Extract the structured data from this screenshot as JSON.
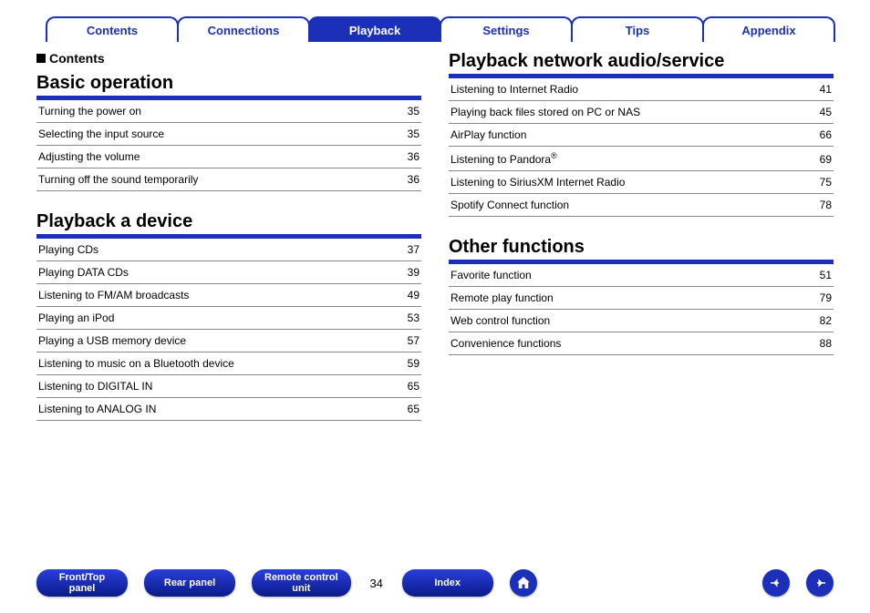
{
  "tabs": [
    {
      "label": "Contents",
      "active": false
    },
    {
      "label": "Connections",
      "active": false
    },
    {
      "label": "Playback",
      "active": true
    },
    {
      "label": "Settings",
      "active": false
    },
    {
      "label": "Tips",
      "active": false
    },
    {
      "label": "Appendix",
      "active": false
    }
  ],
  "contents_header": "Contents",
  "sections": {
    "basic_operation": {
      "title": "Basic operation",
      "rows": [
        {
          "label": "Turning the power on",
          "page": "35"
        },
        {
          "label": "Selecting the input source",
          "page": "35"
        },
        {
          "label": "Adjusting the volume",
          "page": "36"
        },
        {
          "label": "Turning off the sound temporarily",
          "page": "36"
        }
      ]
    },
    "playback_device": {
      "title": "Playback a device",
      "rows": [
        {
          "label": "Playing CDs",
          "page": "37"
        },
        {
          "label": "Playing DATA CDs",
          "page": "39"
        },
        {
          "label": "Listening to FM/AM broadcasts",
          "page": "49"
        },
        {
          "label": "Playing an iPod",
          "page": "53"
        },
        {
          "label": "Playing a USB memory device",
          "page": "57"
        },
        {
          "label": "Listening to music on a Bluetooth device",
          "page": "59"
        },
        {
          "label": "Listening to DIGITAL IN",
          "page": "65"
        },
        {
          "label": "Listening to ANALOG IN",
          "page": "65"
        }
      ]
    },
    "network_audio": {
      "title": "Playback network audio/service",
      "rows": [
        {
          "label": "Listening to Internet Radio",
          "page": "41"
        },
        {
          "label": "Playing back files stored on PC or NAS",
          "page": "45"
        },
        {
          "label": "AirPlay function",
          "page": "66"
        },
        {
          "label": "Listening to Pandora",
          "sup": "®",
          "page": "69"
        },
        {
          "label": "Listening to SiriusXM Internet Radio",
          "page": "75"
        },
        {
          "label": "Spotify Connect function",
          "page": "78"
        }
      ]
    },
    "other_functions": {
      "title": "Other functions",
      "rows": [
        {
          "label": "Favorite function",
          "page": "51"
        },
        {
          "label": "Remote play function",
          "page": "79"
        },
        {
          "label": "Web control function",
          "page": "82"
        },
        {
          "label": "Convenience functions",
          "page": "88"
        }
      ]
    }
  },
  "footer": {
    "front_top_panel": "Front/Top\npanel",
    "rear_panel": "Rear panel",
    "remote_control": "Remote control\nunit",
    "page_number": "34",
    "index": "Index"
  }
}
